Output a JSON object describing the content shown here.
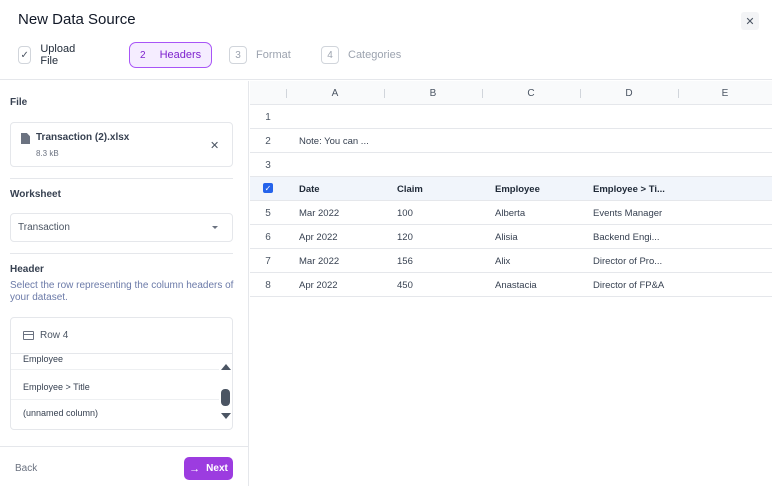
{
  "dialog": {
    "title": "New Data Source",
    "close_icon": "close-icon"
  },
  "steps": [
    {
      "num": "✓",
      "label": "Upload File",
      "state": "done"
    },
    {
      "num": "2",
      "label": "Headers",
      "state": "active"
    },
    {
      "num": "3",
      "label": "Format",
      "state": "upcoming"
    },
    {
      "num": "4",
      "label": "Categories",
      "state": "upcoming"
    }
  ],
  "left": {
    "file_label": "File",
    "file": {
      "name": "Transaction (2).xlsx",
      "size": "8.3 kB"
    },
    "worksheet_label": "Worksheet",
    "worksheet_value": "Transaction",
    "header_label": "Header",
    "header_help": "Select the row representing the column headers of your dataset.",
    "row_selected": "Row 4",
    "options": [
      "Employee",
      "Employee > Title",
      "(unnamed column)"
    ],
    "back_label": "Back",
    "next_label": "Next"
  },
  "grid": {
    "columns": [
      "A",
      "B",
      "C",
      "D",
      "E"
    ],
    "rows": [
      {
        "num": "1",
        "cells": [
          "",
          "",
          "",
          ""
        ]
      },
      {
        "num": "2",
        "cells": [
          "Note: You can ...",
          "",
          "",
          ""
        ]
      },
      {
        "num": "3",
        "cells": [
          "",
          "",
          "",
          ""
        ]
      },
      {
        "num": "",
        "header": true,
        "cells": [
          "Date",
          "Claim",
          "Employee",
          "Employee > Ti..."
        ]
      },
      {
        "num": "5",
        "cells": [
          "Mar 2022",
          "100",
          "Alberta",
          "Events Manager"
        ]
      },
      {
        "num": "6",
        "cells": [
          "Apr 2022",
          "120",
          "Alisia",
          "Backend Engi..."
        ]
      },
      {
        "num": "7",
        "cells": [
          "Mar 2022",
          "156",
          "Alix",
          "Director of Pro..."
        ]
      },
      {
        "num": "8",
        "cells": [
          "Apr 2022",
          "450",
          "Anastacia",
          "Director of FP&A"
        ]
      }
    ]
  },
  "colors": {
    "accent": "#9c3ce0",
    "active_step_bg": "#f5edff",
    "checkbox": "#2563eb"
  }
}
